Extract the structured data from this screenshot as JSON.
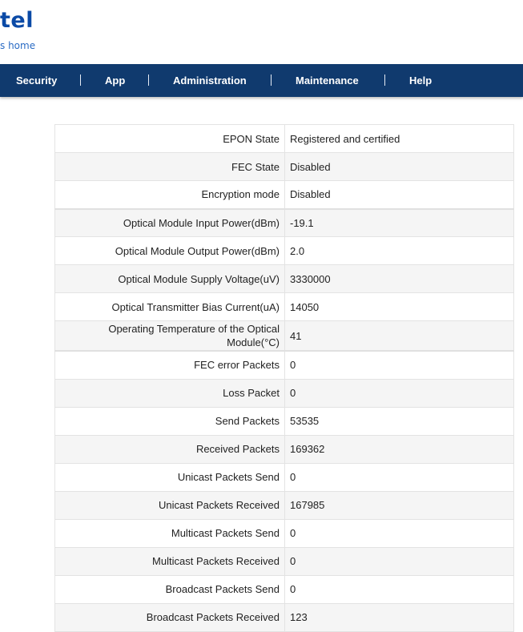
{
  "brand": {
    "name": "tel",
    "tagline": "s home",
    "color": "#0b4aa6"
  },
  "nav": {
    "background": "#103a6e",
    "items": [
      {
        "label": "Security"
      },
      {
        "label": "App"
      },
      {
        "label": "Administration"
      },
      {
        "label": "Maintenance"
      },
      {
        "label": "Help"
      }
    ]
  },
  "status_table": {
    "rows": [
      {
        "label": "EPON State",
        "value": "Registered and certified"
      },
      {
        "label": "FEC State",
        "value": "Disabled"
      },
      {
        "label": "Encryption mode",
        "value": "Disabled"
      },
      {
        "label": "Optical Module Input Power(dBm)",
        "value": "-19.1"
      },
      {
        "label": "Optical Module Output Power(dBm)",
        "value": "2.0"
      },
      {
        "label": "Optical Module Supply Voltage(uV)",
        "value": "3330000"
      },
      {
        "label": "Optical Transmitter Bias Current(uA)",
        "value": "14050"
      },
      {
        "label": "Operating Temperature of the Optical Module(°C)",
        "value": "41"
      },
      {
        "label": "FEC error Packets",
        "value": "0"
      },
      {
        "label": "Loss Packet",
        "value": "0"
      },
      {
        "label": "Send Packets",
        "value": "53535"
      },
      {
        "label": "Received Packets",
        "value": "169362"
      },
      {
        "label": "Unicast Packets Send",
        "value": "0"
      },
      {
        "label": "Unicast Packets Received",
        "value": "167985"
      },
      {
        "label": "Multicast Packets Send",
        "value": "0"
      },
      {
        "label": "Multicast Packets Received",
        "value": "0"
      },
      {
        "label": "Broadcast Packets Send",
        "value": "0"
      },
      {
        "label": "Broadcast Packets Received",
        "value": "123"
      }
    ]
  }
}
